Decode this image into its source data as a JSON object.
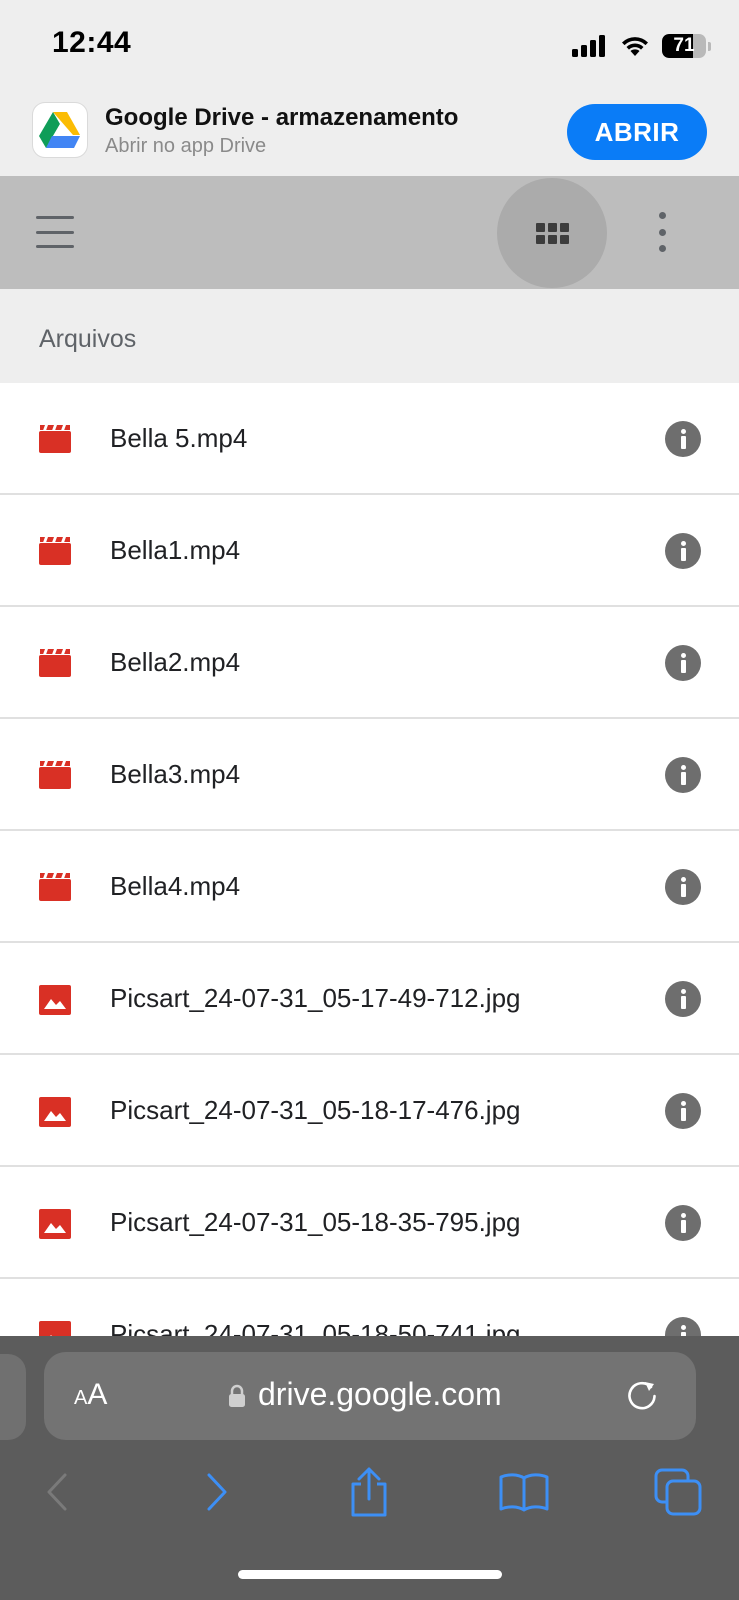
{
  "status_bar": {
    "time": "12:44",
    "battery_percent": "71",
    "battery_level": 0.71
  },
  "app_banner": {
    "title": "Google Drive - armazenamento",
    "subtitle": "Abrir no app Drive",
    "open_label": "ABRIR"
  },
  "toolbar": {
    "menu_icon": "hamburger-menu-icon",
    "view_icon": "grid-view-icon",
    "more_icon": "more-vertical-icon"
  },
  "section": {
    "title": "Arquivos"
  },
  "files": [
    {
      "name": "Bella 5.mp4",
      "type": "video"
    },
    {
      "name": "Bella1.mp4",
      "type": "video"
    },
    {
      "name": "Bella2.mp4",
      "type": "video"
    },
    {
      "name": "Bella3.mp4",
      "type": "video"
    },
    {
      "name": "Bella4.mp4",
      "type": "video"
    },
    {
      "name": "Picsart_24-07-31_05-17-49-712.jpg",
      "type": "image"
    },
    {
      "name": "Picsart_24-07-31_05-18-17-476.jpg",
      "type": "image"
    },
    {
      "name": "Picsart_24-07-31_05-18-35-795.jpg",
      "type": "image"
    },
    {
      "name": "Picsart_24-07-31_05-18-50-741.jpg",
      "type": "image"
    }
  ],
  "safari": {
    "reader_small": "A",
    "reader_large": "A",
    "url": "drive.google.com"
  },
  "colors": {
    "accent_blue": "#0a7cf7",
    "file_icon_red": "#d93025",
    "toolbar_gray": "#bdbdbd",
    "safari_blue": "#3d8ff5"
  }
}
